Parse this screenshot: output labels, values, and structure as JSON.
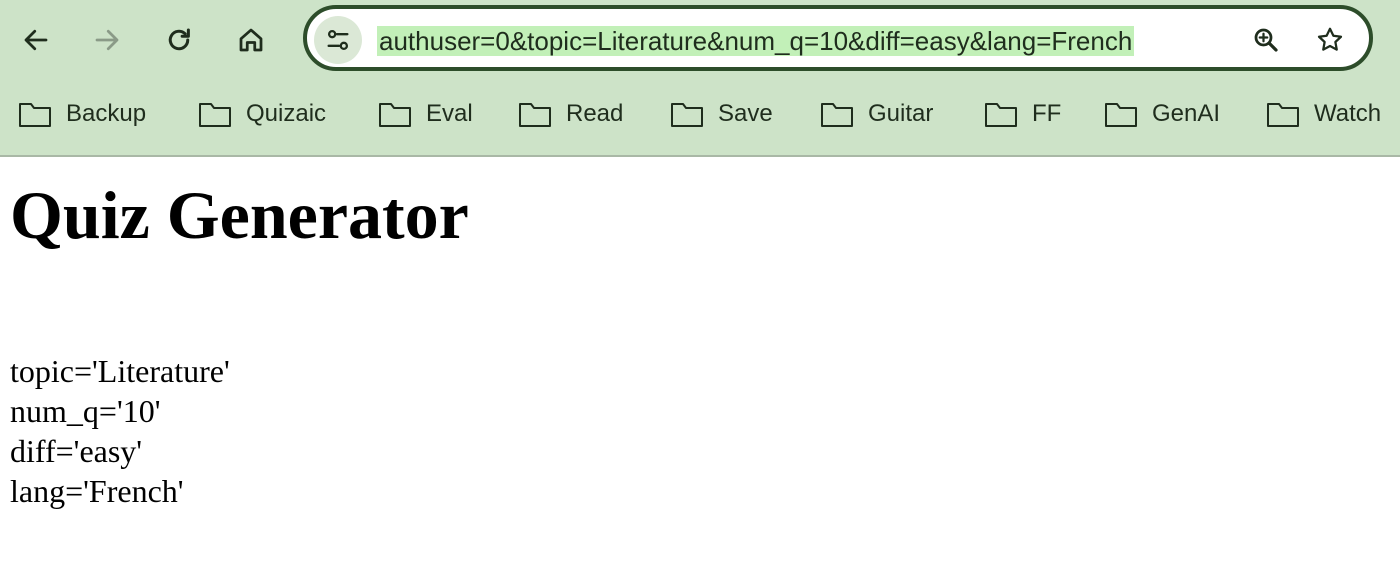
{
  "browser": {
    "url_visible": "authuser=0&topic=Literature&num_q=10&diff=easy&lang=French",
    "toolbar": {
      "back_icon": "arrow-left-icon",
      "forward_icon": "arrow-right-icon",
      "reload_icon": "reload-icon",
      "home_icon": "home-icon",
      "site_info_icon": "tune-icon",
      "zoom_icon": "zoom-icon",
      "bookmark_star_icon": "star-icon"
    },
    "bookmarks": [
      {
        "label": "Backup",
        "icon": "folder-icon"
      },
      {
        "label": "Quizaic",
        "icon": "folder-icon"
      },
      {
        "label": "Eval",
        "icon": "folder-icon"
      },
      {
        "label": "Read",
        "icon": "folder-icon"
      },
      {
        "label": "Save",
        "icon": "folder-icon"
      },
      {
        "label": "Guitar",
        "icon": "folder-icon"
      },
      {
        "label": "FF",
        "icon": "folder-icon"
      },
      {
        "label": "GenAI",
        "icon": "folder-icon"
      },
      {
        "label": "Watch",
        "icon": "folder-icon"
      }
    ],
    "colors": {
      "chrome_background": "#cde3c8",
      "url_highlight": "#c2f0b8",
      "omnibox_border": "#2d4d2a"
    }
  },
  "page": {
    "title": "Quiz Generator",
    "params": [
      "topic='Literature'",
      "num_q='10'",
      "diff='easy'",
      "lang='French'"
    ]
  }
}
